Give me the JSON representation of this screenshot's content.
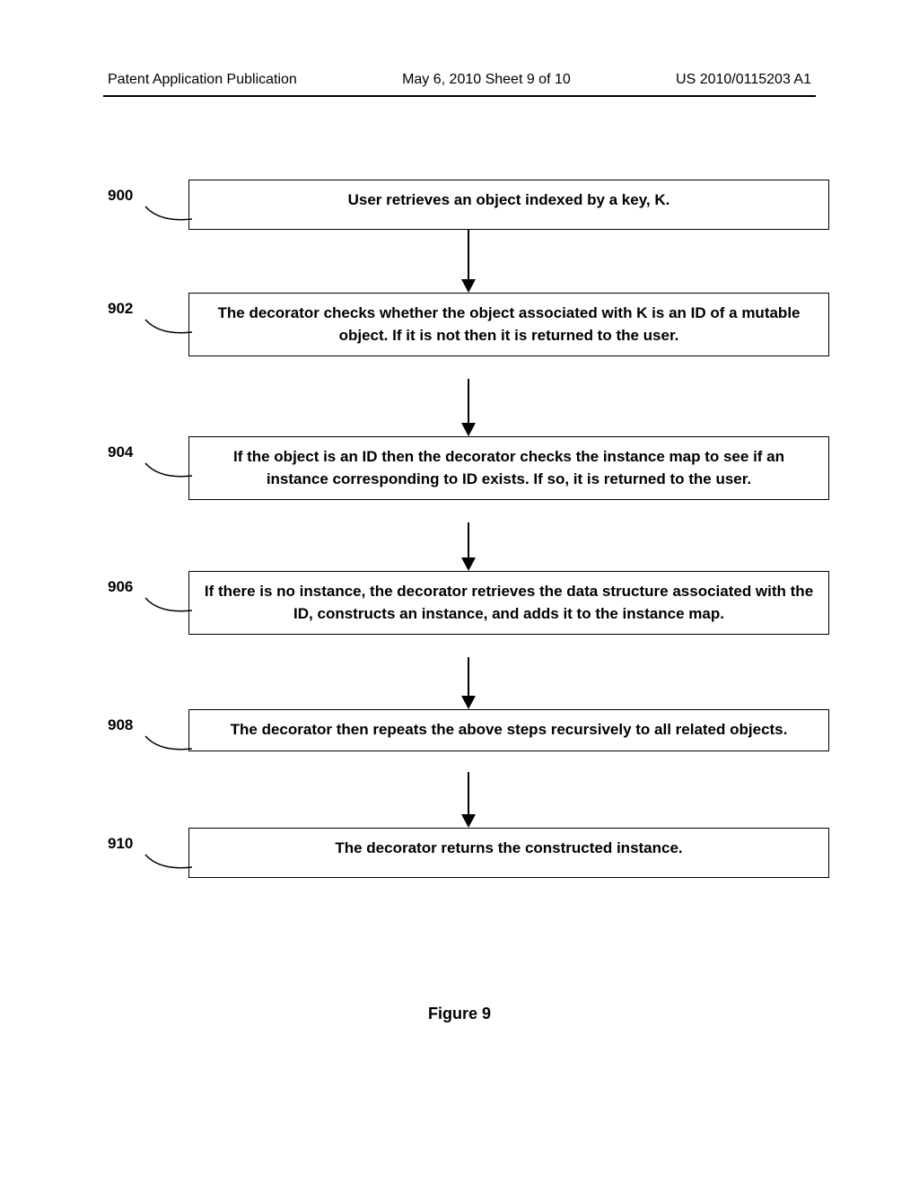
{
  "header": {
    "left": "Patent Application Publication",
    "center": "May 6, 2010  Sheet 9 of 10",
    "right": "US 2010/0115203 A1"
  },
  "steps": [
    {
      "num": "900",
      "text": "User retrieves an object indexed by a key, K."
    },
    {
      "num": "902",
      "text": "The decorator checks whether the object associated with K is an ID of a mutable object.  If it is not then it is returned to the user."
    },
    {
      "num": "904",
      "text": "If the object is an ID then the decorator checks the instance map to see if an instance corresponding to ID exists.  If so, it is returned to the user."
    },
    {
      "num": "906",
      "text": "If there is no instance, the decorator retrieves the data structure associated with the ID, constructs an instance, and adds it to the instance map."
    },
    {
      "num": "908",
      "text": "The decorator then repeats the above steps recursively to all related objects."
    },
    {
      "num": "910",
      "text": "The decorator returns the constructed instance."
    }
  ],
  "caption": "Figure 9"
}
